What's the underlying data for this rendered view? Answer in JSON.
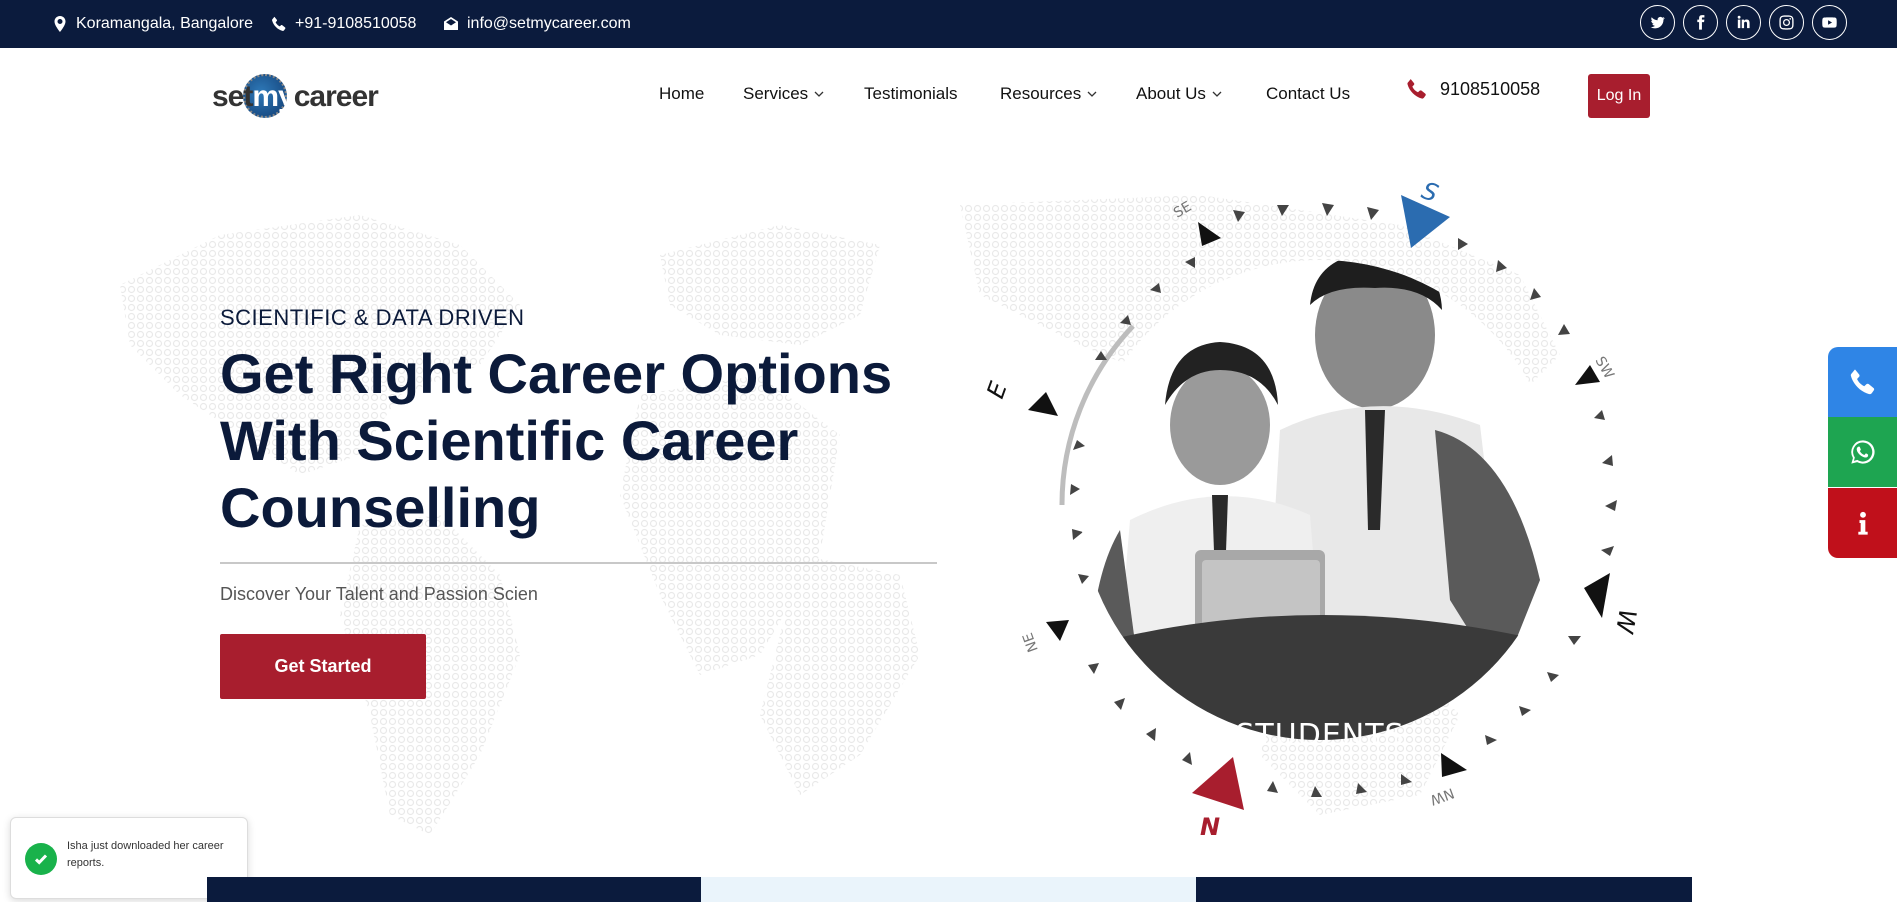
{
  "topbar": {
    "address": "Koramangala, Bangalore",
    "phone": "+91-9108510058",
    "email": "info@setmycareer.com",
    "social": [
      "twitter-icon",
      "facebook-icon",
      "linkedin-icon",
      "instagram-icon",
      "youtube-icon"
    ]
  },
  "nav": {
    "logo": "setmycareer",
    "items": [
      {
        "label": "Home"
      },
      {
        "label": "Services"
      },
      {
        "label": "Testimonials"
      },
      {
        "label": "Resources"
      },
      {
        "label": "About Us"
      },
      {
        "label": "Contact Us"
      }
    ],
    "phone": "9108510058",
    "login": "Log In"
  },
  "hero": {
    "tagline": "SCIENTIFIC & DATA DRIVEN",
    "headline_line1": "Get Right Career Options",
    "headline_line2": "With Scientific Career",
    "headline_line3": "Counselling",
    "subtext": "Discover Your Talent and Passion Scien",
    "cta": "Get Started",
    "badge": "STUDENTS",
    "compass_labels": {
      "n": "N",
      "s": "S",
      "e": "E",
      "w": "W",
      "se": "SE",
      "sw": "SW",
      "ne": "NE",
      "nw": "NW"
    }
  },
  "floating": [
    "phone-icon",
    "whatsapp-icon",
    "info-icon"
  ],
  "toast": {
    "message": "Isha just downloaded her career reports."
  },
  "colors": {
    "navy": "#0b1b3d",
    "brand_red": "#a81e2e",
    "call_blue": "#2f85e6",
    "whatsapp_green": "#1ea551",
    "info_red": "#c0101b",
    "compass_blue": "#2b6cb0"
  }
}
